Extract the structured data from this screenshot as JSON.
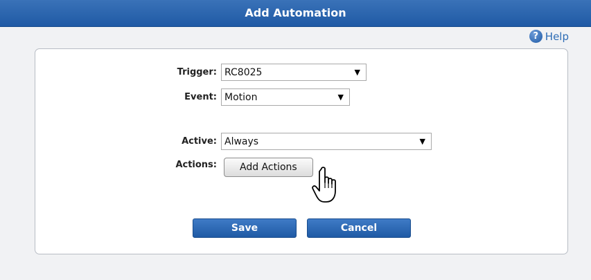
{
  "dialog": {
    "title": "Add Automation",
    "help_label": "Help"
  },
  "form": {
    "trigger": {
      "label": "Trigger:",
      "value": "RC8025"
    },
    "event": {
      "label": "Event:",
      "value": "Motion"
    },
    "active": {
      "label": "Active:",
      "value": "Always"
    },
    "actions": {
      "label": "Actions:",
      "button_label": "Add Actions"
    }
  },
  "buttons": {
    "save_label": "Save",
    "cancel_label": "Cancel"
  },
  "icons": {
    "help": "help-icon",
    "dropdown": "chevron-down-icon",
    "cursor": "hand-pointer-icon"
  },
  "colors": {
    "titlebar": "#1f5aa5",
    "primary_button": "#1f5aa5",
    "help_link": "#2d6cb5",
    "background": "#f1f2f4"
  }
}
